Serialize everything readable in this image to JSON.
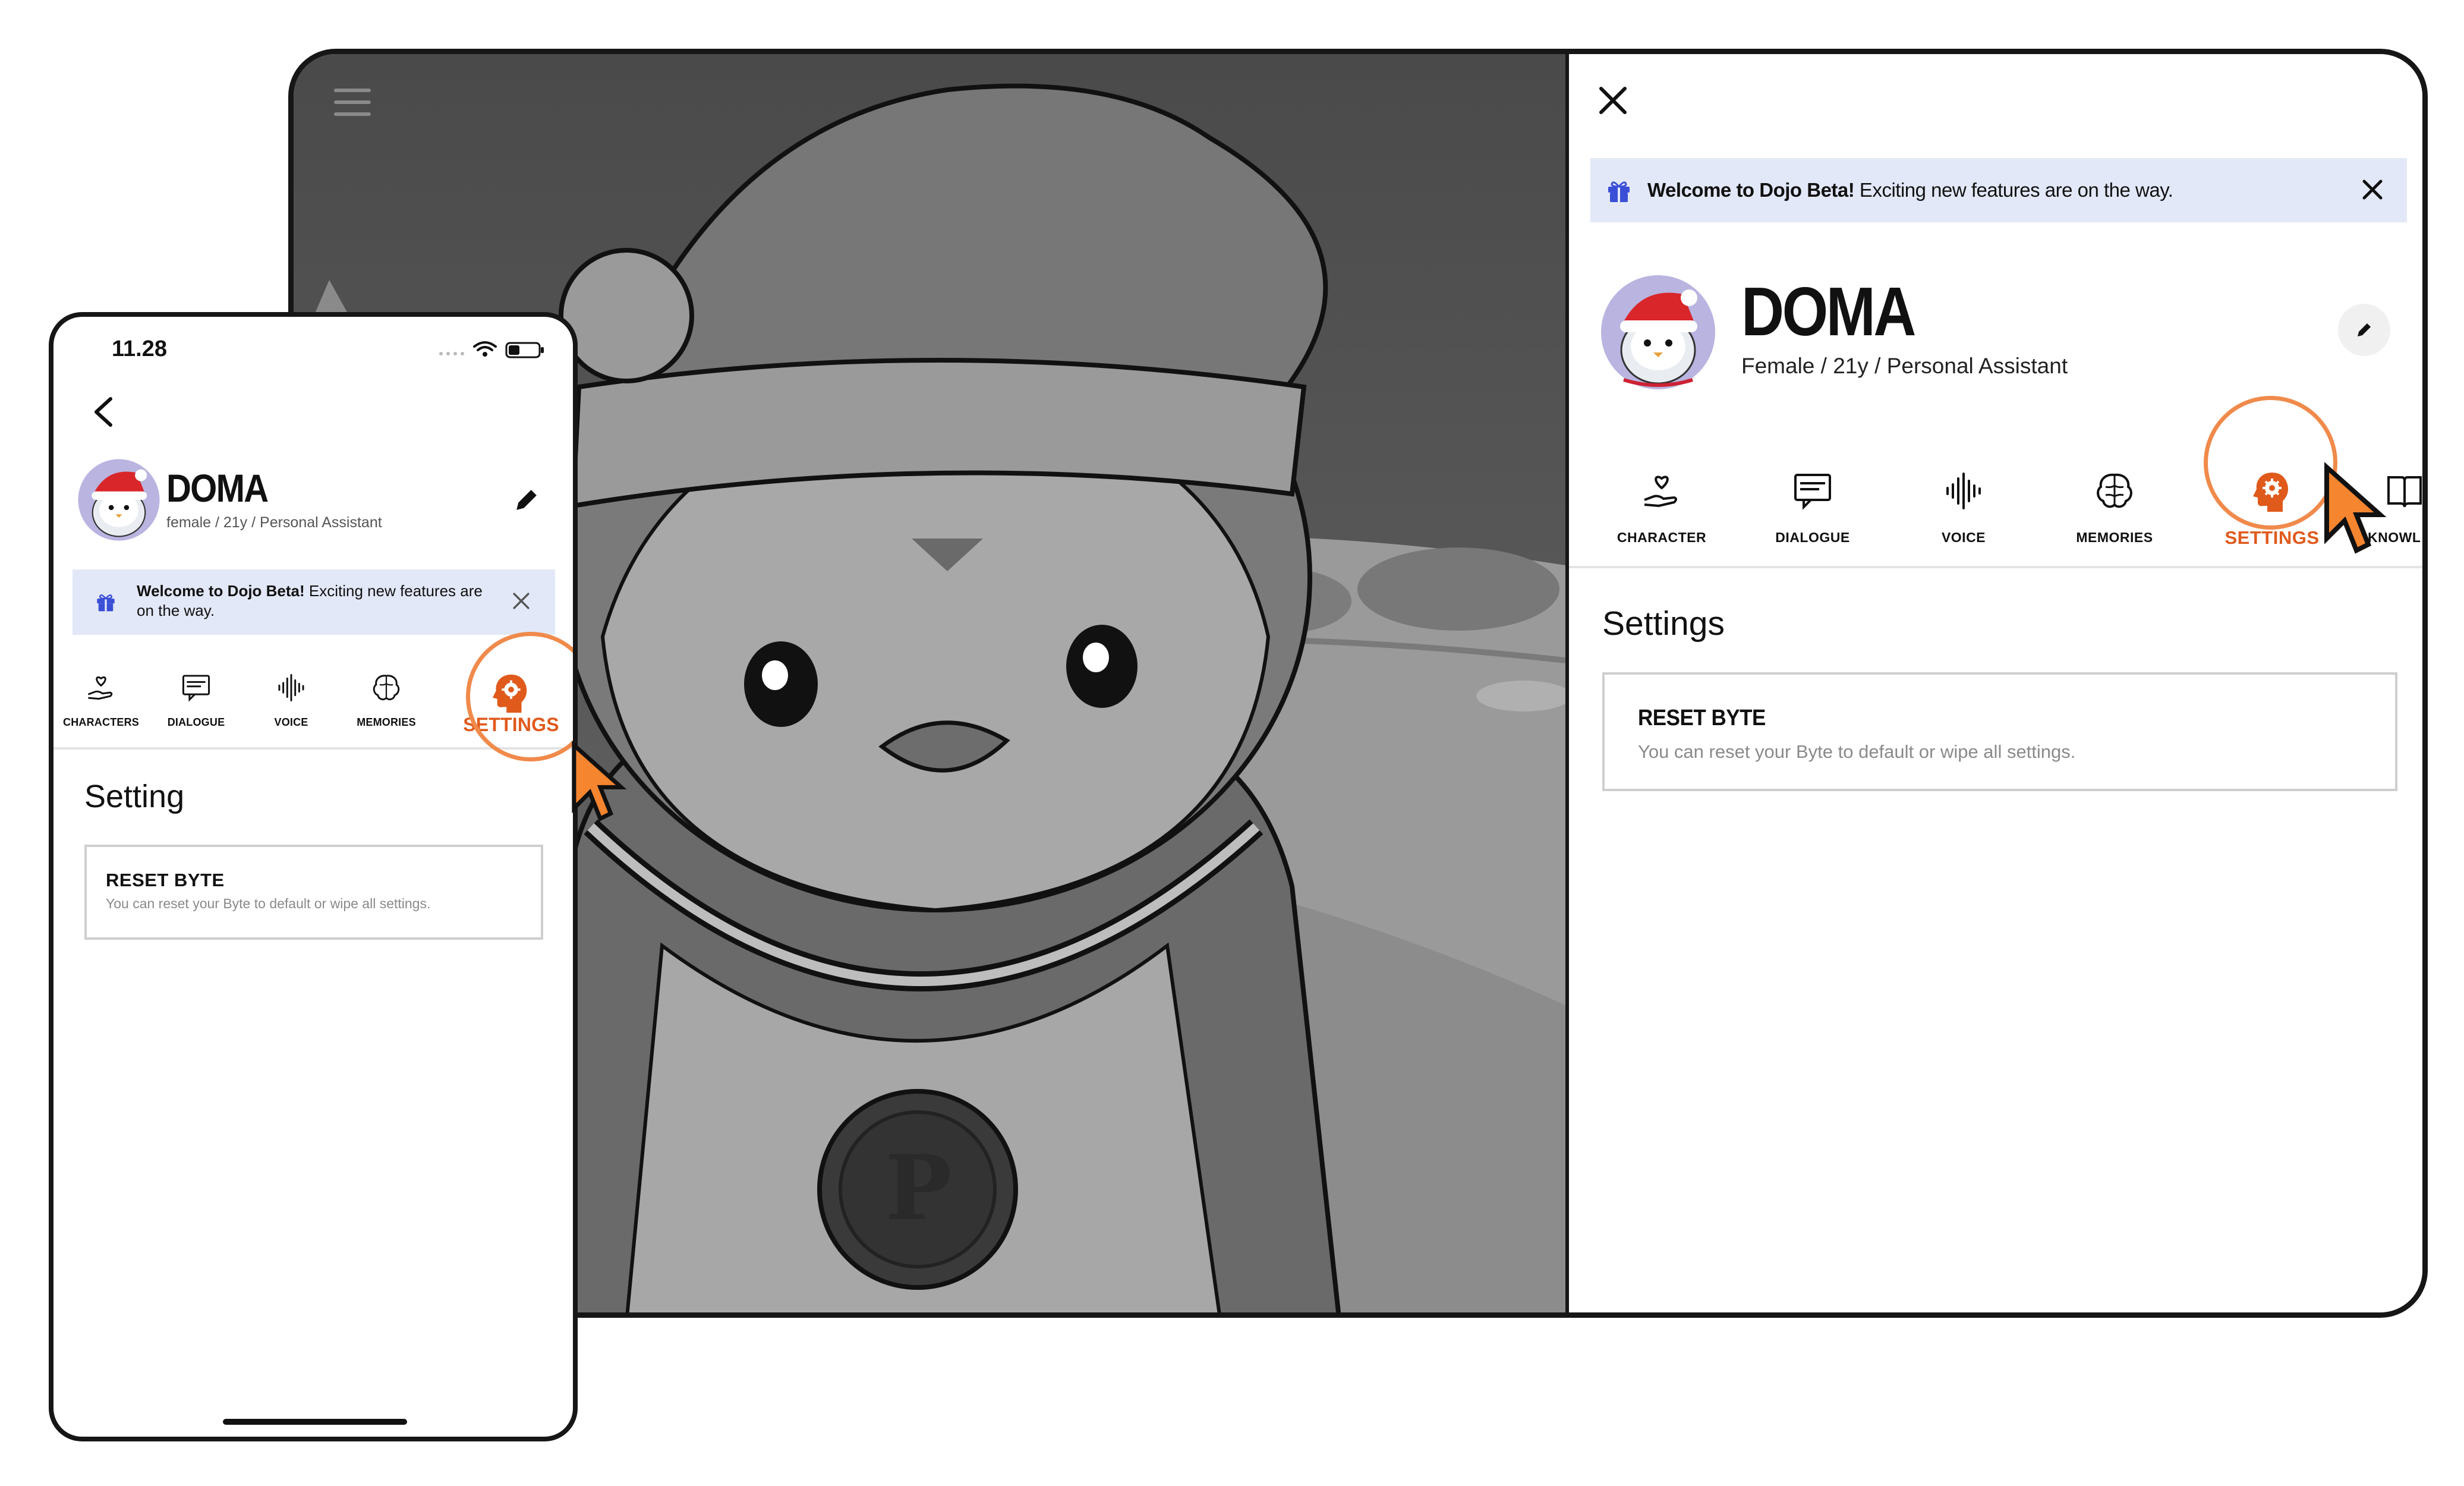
{
  "colors": {
    "accent": "#e05a1c",
    "highlight_ring": "#f08a4b",
    "banner_bg": "#e3e8f8",
    "gift_icon": "#3a4fd6",
    "scene_gray": "#5a5a5a"
  },
  "tablet": {
    "banner": {
      "bold": "Welcome to Dojo Beta!",
      "text": " Exciting new features are on the way.",
      "icon": "gift-icon"
    },
    "profile": {
      "name": "DOMA",
      "subtitle": "Female / 21y / Personal Assistant"
    },
    "tabs": [
      {
        "label": "CHARACTER",
        "icon": "heart-hand-icon"
      },
      {
        "label": "DIALOGUE",
        "icon": "chat-icon"
      },
      {
        "label": "VOICE",
        "icon": "waveform-icon"
      },
      {
        "label": "MEMORIES",
        "icon": "brain-icon"
      },
      {
        "label": "SETTINGS",
        "icon": "gear-head-icon",
        "active": true
      },
      {
        "label": "KNOWL",
        "icon": "book-icon"
      }
    ],
    "section_title": "Settings",
    "card": {
      "title": "RESET BYTE",
      "description": "You can reset your Byte to default or wipe all settings."
    }
  },
  "phone": {
    "status": {
      "time": "11.28"
    },
    "profile": {
      "name": "DOMA",
      "subtitle": "female / 21y / Personal Assistant"
    },
    "banner": {
      "bold": "Welcome to Dojo Beta!",
      "text": " Exciting new features are on the way.",
      "icon": "gift-icon"
    },
    "tabs": [
      {
        "label": "CHARACTERS",
        "icon": "heart-hand-icon"
      },
      {
        "label": "DIALOGUE",
        "icon": "chat-icon"
      },
      {
        "label": "VOICE",
        "icon": "waveform-icon"
      },
      {
        "label": "MEMORIES",
        "icon": "brain-icon"
      },
      {
        "label": "SETTINGS",
        "icon": "gear-head-icon",
        "active": true
      }
    ],
    "section_title": "Setting",
    "card": {
      "title": "RESET BYTE",
      "description": "You can reset your Byte to default or wipe all settings."
    }
  }
}
